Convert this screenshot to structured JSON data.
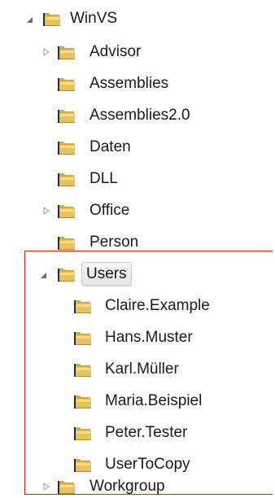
{
  "tree": {
    "root": {
      "label": "WinVS",
      "icon": "folder-icon",
      "expander": "expanded-triangle-icon"
    },
    "children": [
      {
        "key": "advisor",
        "label": "Advisor",
        "icon": "folder-icon",
        "expander": "collapsed-triangle-icon"
      },
      {
        "key": "assemblies",
        "label": "Assemblies",
        "icon": "folder-icon",
        "expander": "none"
      },
      {
        "key": "assemblies2",
        "label": "Assemblies2.0",
        "icon": "folder-icon",
        "expander": "none"
      },
      {
        "key": "daten",
        "label": "Daten",
        "icon": "folder-icon",
        "expander": "none"
      },
      {
        "key": "dll",
        "label": "DLL",
        "icon": "folder-icon",
        "expander": "none"
      },
      {
        "key": "office",
        "label": "Office",
        "icon": "folder-icon",
        "expander": "collapsed-triangle-icon"
      },
      {
        "key": "person",
        "label": "Person",
        "icon": "folder-icon",
        "expander": "none"
      },
      {
        "key": "users",
        "label": "Users",
        "icon": "folder-icon",
        "expander": "expanded-triangle-icon",
        "selected": true
      },
      {
        "key": "workgroup",
        "label": "Workgroup",
        "icon": "folder-icon",
        "expander": "collapsed-triangle-icon"
      }
    ],
    "users_children": [
      {
        "key": "claire",
        "label": "Claire.Example",
        "icon": "folder-icon"
      },
      {
        "key": "hans",
        "label": "Hans.Muster",
        "icon": "folder-icon"
      },
      {
        "key": "karl",
        "label": "Karl.Müller",
        "icon": "folder-icon"
      },
      {
        "key": "maria",
        "label": "Maria.Beispiel",
        "icon": "folder-icon"
      },
      {
        "key": "peter",
        "label": "Peter.Tester",
        "icon": "folder-icon"
      },
      {
        "key": "usertocopy",
        "label": "UserToCopy",
        "icon": "folder-icon"
      }
    ]
  },
  "colors": {
    "folder_body": "#e9c25a",
    "folder_back": "#d9a93a",
    "folder_light": "#f6dc8c",
    "folder_shadow": "#b98a2a",
    "folder_dark_side": "#2b2b2b",
    "expander": "#9a9a9a",
    "expander_open": "#6a6a6a",
    "highlight_border": "#e41d1d",
    "selection_border": "#c8c8c8"
  }
}
